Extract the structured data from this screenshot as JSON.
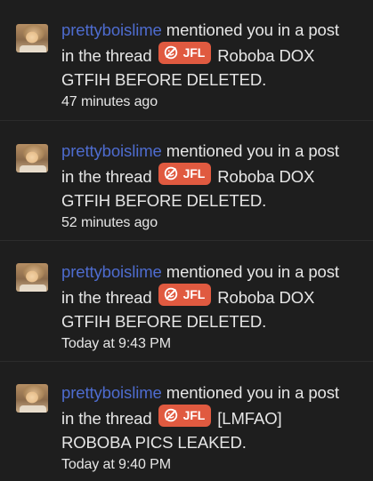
{
  "alerts": [
    {
      "username": "prettyboislime",
      "action": "mentioned you in a post in the thread",
      "prefix": "JFL",
      "thread_title": "Roboba DOX GTFIH BEFORE DELETED.",
      "time": "47 minutes ago"
    },
    {
      "username": "prettyboislime",
      "action": "mentioned you in a post in the thread",
      "prefix": "JFL",
      "thread_title": "Roboba DOX GTFIH BEFORE DELETED.",
      "time": "52 minutes ago"
    },
    {
      "username": "prettyboislime",
      "action": "mentioned you in a post in the thread",
      "prefix": "JFL",
      "thread_title": "Roboba DOX GTFIH BEFORE DELETED.",
      "time": "Today at 9:43 PM"
    },
    {
      "username": "prettyboislime",
      "action": "mentioned you in a post in the thread",
      "prefix": "JFL",
      "thread_title": "[LMFAO] ROBOBA PICS LEAKED.",
      "time": "Today at 9:40 PM"
    }
  ],
  "colors": {
    "background": "#1e1e1e",
    "username": "#4e6ccf",
    "prefix_badge": "#e05a40",
    "text": "#e6e6e6"
  },
  "icons": {
    "avatar": "user-avatar-photo",
    "prefix": "no-laughing-icon"
  }
}
